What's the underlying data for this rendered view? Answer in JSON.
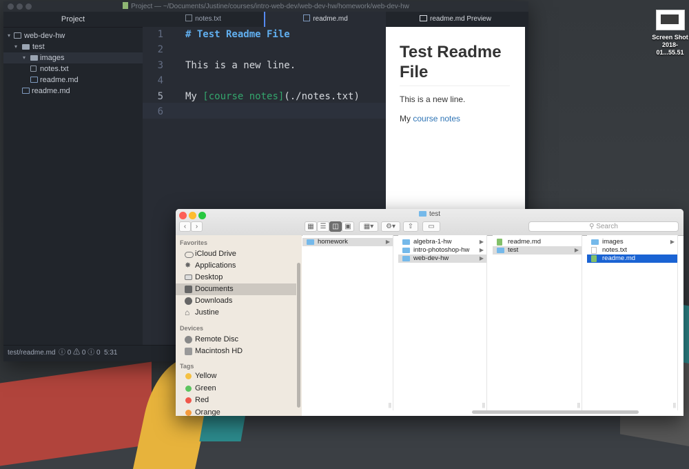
{
  "desktop": {
    "file": {
      "name_line1": "Screen Shot",
      "name_line2": "2018-01...55.51"
    }
  },
  "atom": {
    "title": "Project — ~/Documents/Justine/courses/intro-web-dev/web-dev-hw/homework/web-dev-hw",
    "tree": {
      "header": "Project",
      "items": [
        {
          "label": "web-dev-hw"
        },
        {
          "label": "test"
        },
        {
          "label": "images"
        },
        {
          "label": "notes.txt"
        },
        {
          "label": "readme.md"
        },
        {
          "label": "readme.md"
        }
      ]
    },
    "tabs": [
      {
        "label": "notes.txt"
      },
      {
        "label": "readme.md"
      },
      {
        "label": "readme.md Preview"
      }
    ],
    "editor": {
      "line_numbers": [
        "1",
        "2",
        "3",
        "4",
        "5",
        "6"
      ],
      "line1": "# Test Readme File",
      "line3": "This is a new line.",
      "line5_prefix": "My ",
      "line5_link_open": "[",
      "line5_link_text": "course notes",
      "line5_link_close": "]",
      "line5_url": "(./notes.txt)"
    },
    "preview": {
      "heading": "Test Readme File",
      "paragraph": "This is a new line.",
      "p2_prefix": "My ",
      "p2_link": "course notes"
    },
    "status": {
      "path": "test/readme.md",
      "errors": "0",
      "warnings": "0",
      "infos": "0",
      "cursor": "5:31"
    }
  },
  "finder": {
    "title": "test",
    "search_placeholder": "Search",
    "sidebar": {
      "favorites_header": "Favorites",
      "favorites": [
        "iCloud Drive",
        "Applications",
        "Desktop",
        "Documents",
        "Downloads",
        "Justine"
      ],
      "devices_header": "Devices",
      "devices": [
        "Remote Disc",
        "Macintosh HD"
      ],
      "tags_header": "Tags",
      "tags": [
        {
          "label": "Yellow",
          "color": "#f5c142"
        },
        {
          "label": "Green",
          "color": "#5cc45f"
        },
        {
          "label": "Red",
          "color": "#f0574b"
        },
        {
          "label": "Orange",
          "color": "#f59a3c"
        }
      ]
    },
    "columns": [
      [
        "homework"
      ],
      [
        "algebra-1-hw",
        "intro-photoshop-hw",
        "web-dev-hw"
      ],
      [
        "readme.md",
        "test"
      ],
      [
        "images",
        "notes.txt",
        "readme.md"
      ]
    ]
  }
}
